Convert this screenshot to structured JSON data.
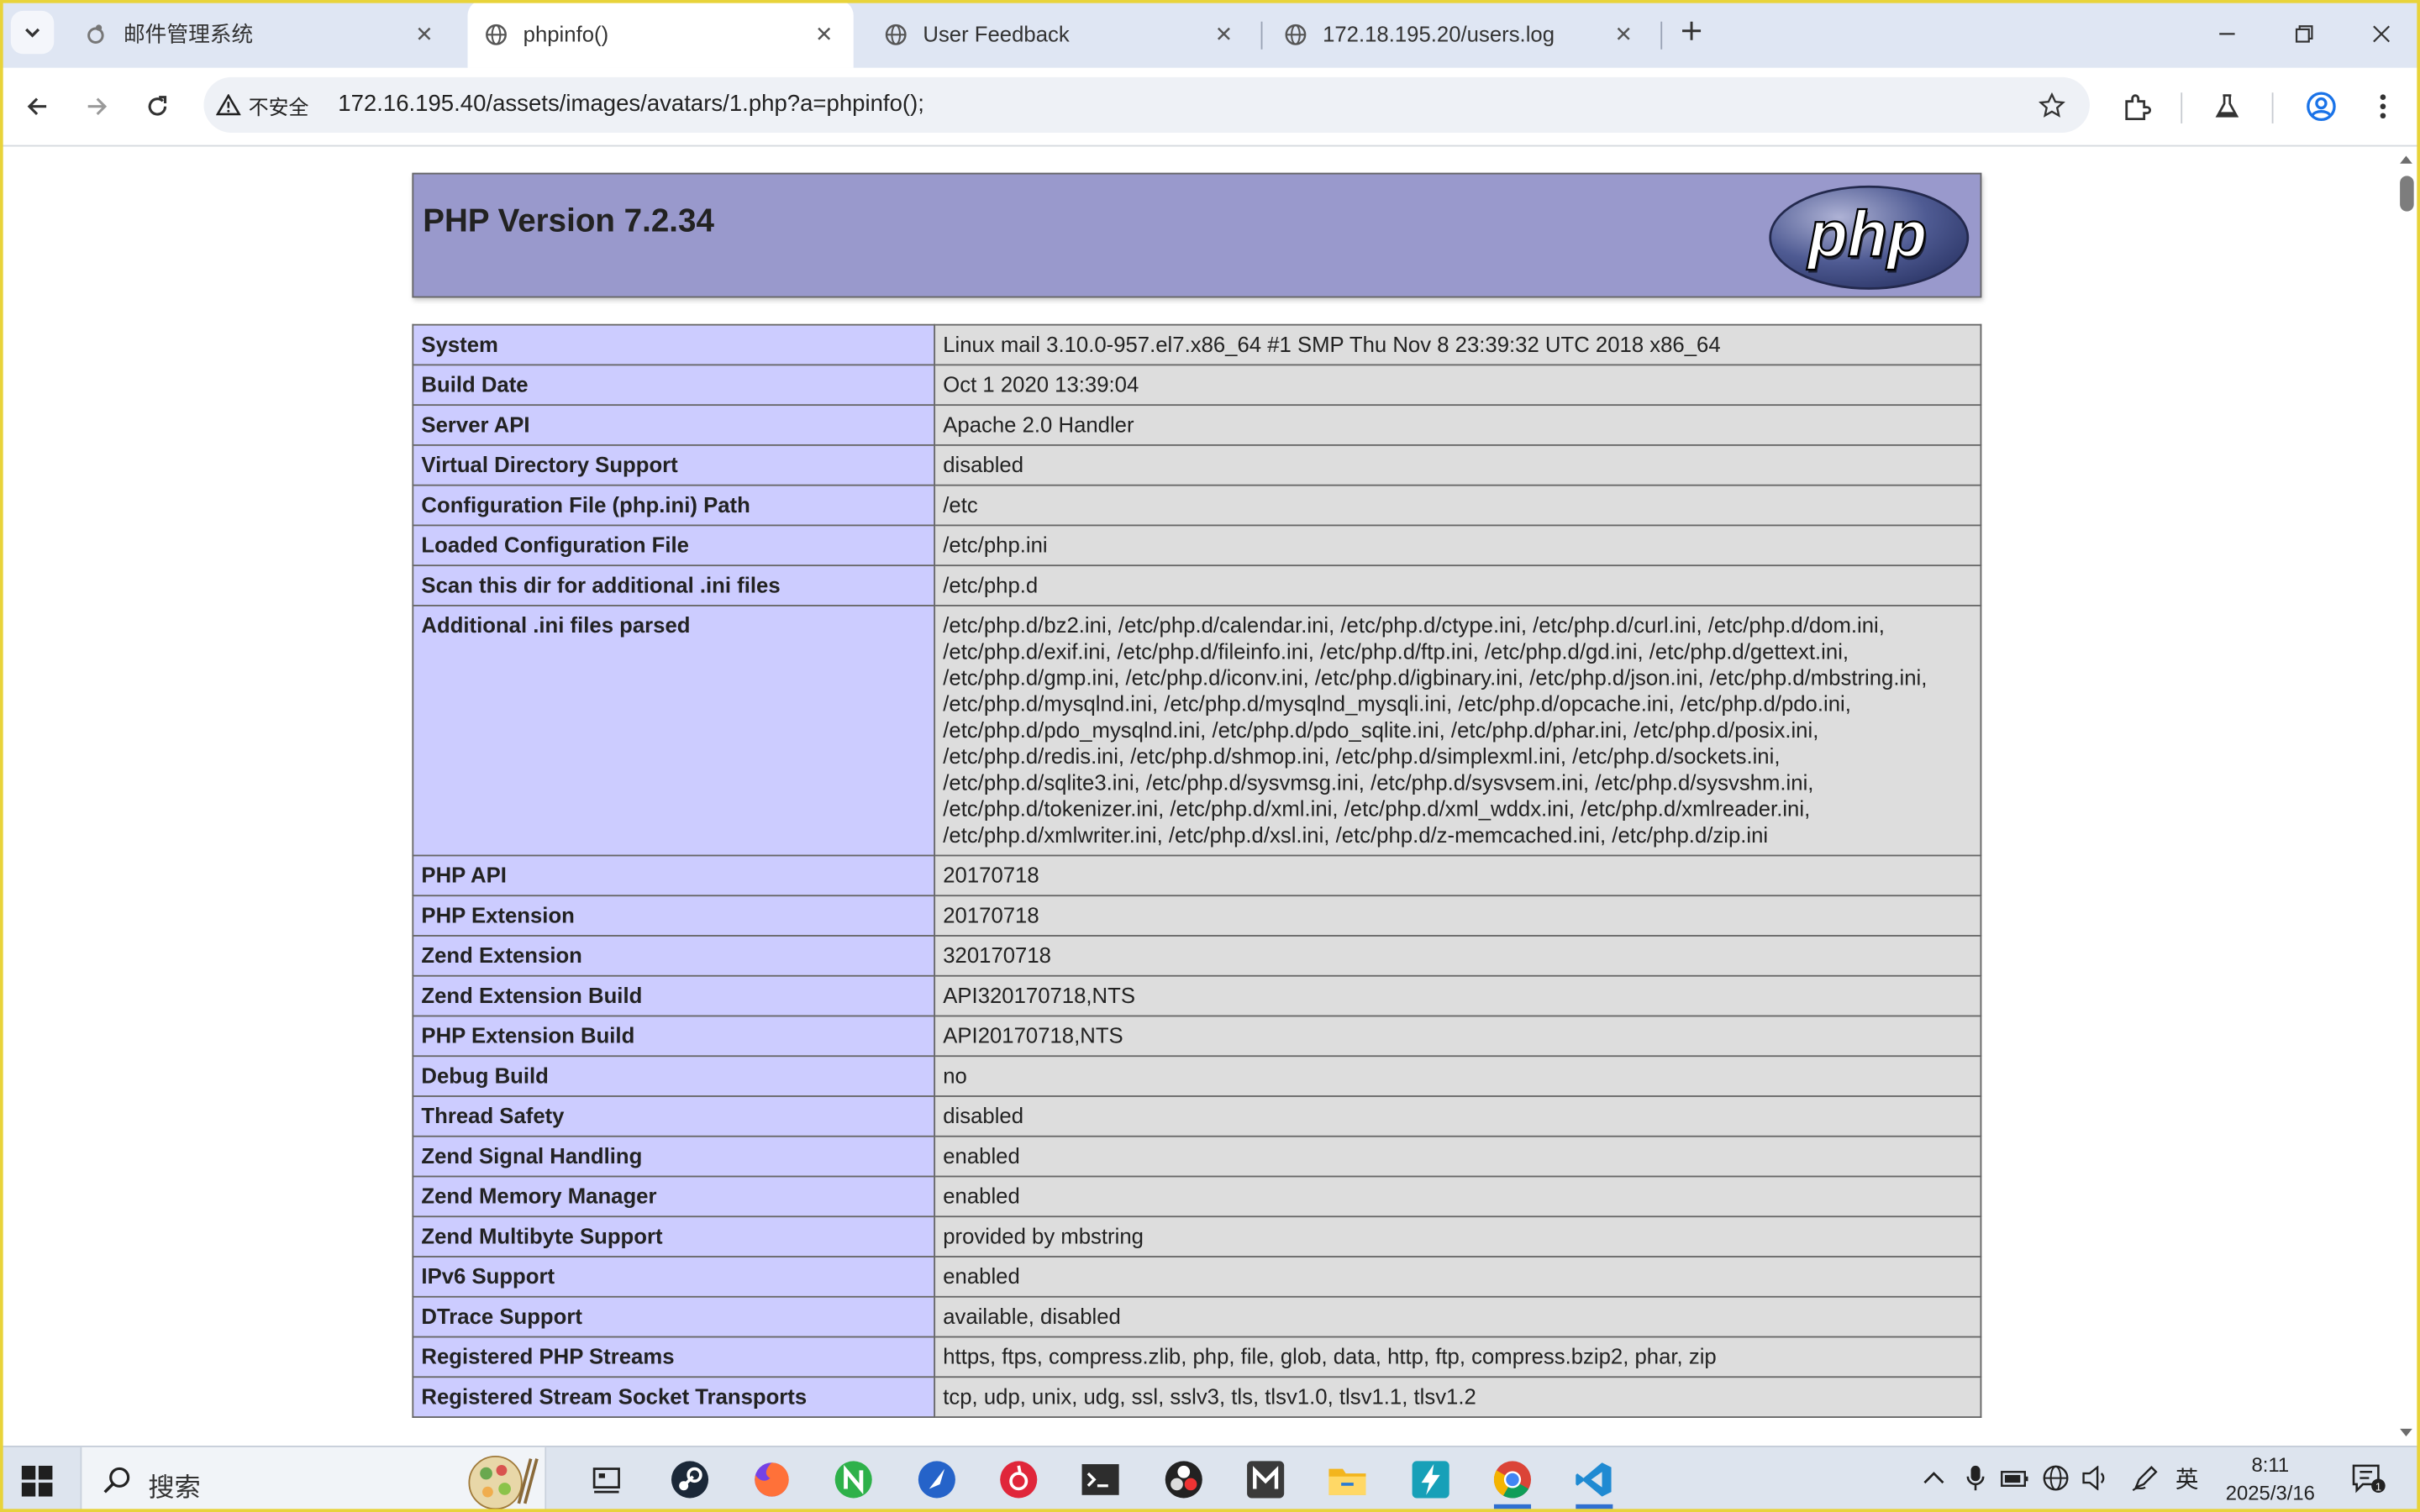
{
  "browser": {
    "tabs": [
      {
        "title": "邮件管理系统",
        "icon": "mail-app-icon",
        "active": false
      },
      {
        "title": "phpinfo()",
        "icon": "globe-icon",
        "active": true
      },
      {
        "title": "User Feedback",
        "icon": "globe-icon",
        "active": false
      },
      {
        "title": "172.18.195.20/users.log",
        "icon": "globe-icon",
        "active": false
      }
    ],
    "security_label": "不安全",
    "url": "172.16.195.40/assets/images/avatars/1.php?a=phpinfo();"
  },
  "page": {
    "header_title": "PHP Version 7.2.34",
    "logo_text": "php",
    "rows": [
      {
        "k": "System",
        "v": "Linux mail 3.10.0-957.el7.x86_64 #1 SMP Thu Nov 8 23:39:32 UTC 2018 x86_64"
      },
      {
        "k": "Build Date",
        "v": "Oct 1 2020 13:39:04"
      },
      {
        "k": "Server API",
        "v": "Apache 2.0 Handler"
      },
      {
        "k": "Virtual Directory Support",
        "v": "disabled"
      },
      {
        "k": "Configuration File (php.ini) Path",
        "v": "/etc"
      },
      {
        "k": "Loaded Configuration File",
        "v": "/etc/php.ini"
      },
      {
        "k": "Scan this dir for additional .ini files",
        "v": "/etc/php.d"
      },
      {
        "k": "Additional .ini files parsed",
        "v": "/etc/php.d/bz2.ini, /etc/php.d/calendar.ini, /etc/php.d/ctype.ini, /etc/php.d/curl.ini, /etc/php.d/dom.ini, /etc/php.d/exif.ini, /etc/php.d/fileinfo.ini, /etc/php.d/ftp.ini, /etc/php.d/gd.ini, /etc/php.d/gettext.ini, /etc/php.d/gmp.ini, /etc/php.d/iconv.ini, /etc/php.d/igbinary.ini, /etc/php.d/json.ini, /etc/php.d/mbstring.ini, /etc/php.d/mysqlnd.ini, /etc/php.d/mysqlnd_mysqli.ini, /etc/php.d/opcache.ini, /etc/php.d/pdo.ini, /etc/php.d/pdo_mysqlnd.ini, /etc/php.d/pdo_sqlite.ini, /etc/php.d/phar.ini, /etc/php.d/posix.ini, /etc/php.d/redis.ini, /etc/php.d/shmop.ini, /etc/php.d/simplexml.ini, /etc/php.d/sockets.ini, /etc/php.d/sqlite3.ini, /etc/php.d/sysvmsg.ini, /etc/php.d/sysvsem.ini, /etc/php.d/sysvshm.ini, /etc/php.d/tokenizer.ini, /etc/php.d/xml.ini, /etc/php.d/xml_wddx.ini, /etc/php.d/xmlreader.ini, /etc/php.d/xmlwriter.ini, /etc/php.d/xsl.ini, /etc/php.d/z-memcached.ini, /etc/php.d/zip.ini"
      },
      {
        "k": "PHP API",
        "v": "20170718"
      },
      {
        "k": "PHP Extension",
        "v": "20170718"
      },
      {
        "k": "Zend Extension",
        "v": "320170718"
      },
      {
        "k": "Zend Extension Build",
        "v": "API320170718,NTS"
      },
      {
        "k": "PHP Extension Build",
        "v": "API20170718,NTS"
      },
      {
        "k": "Debug Build",
        "v": "no"
      },
      {
        "k": "Thread Safety",
        "v": "disabled"
      },
      {
        "k": "Zend Signal Handling",
        "v": "enabled"
      },
      {
        "k": "Zend Memory Manager",
        "v": "enabled"
      },
      {
        "k": "Zend Multibyte Support",
        "v": "provided by mbstring"
      },
      {
        "k": "IPv6 Support",
        "v": "enabled"
      },
      {
        "k": "DTrace Support",
        "v": "available, disabled"
      },
      {
        "k": "Registered PHP Streams",
        "v": "https, ftps, compress.zlib, php, file, glob, data, http, ftp, compress.bzip2, phar, zip"
      },
      {
        "k": "Registered Stream Socket Transports",
        "v": "tcp, udp, unix, udg, ssl, sslv3, tls, tlsv1.0, tlsv1.1, tlsv1.2"
      }
    ]
  },
  "taskbar": {
    "search_label": "搜索",
    "apps": [
      {
        "name": "food-wallpaper-icon",
        "color": "#c8a35a"
      },
      {
        "name": "task-view-icon",
        "color": "#2b2b2b"
      },
      {
        "name": "steam-icon",
        "color": "#1b2838"
      },
      {
        "name": "firefox-icon",
        "color": "#e66000"
      },
      {
        "name": "n-app-icon",
        "color": "#2eb14a"
      },
      {
        "name": "feather-app-icon",
        "color": "#2563c9"
      },
      {
        "name": "netease-music-icon",
        "color": "#e0263a"
      },
      {
        "name": "terminal-icon",
        "color": "#2d2d2d"
      },
      {
        "name": "obs-icon",
        "color": "#222222"
      },
      {
        "name": "m-app-icon",
        "color": "#3a3a3a"
      },
      {
        "name": "file-explorer-icon",
        "color": "#f3b51d"
      },
      {
        "name": "bolt-app-icon",
        "color": "#17a0b8"
      },
      {
        "name": "chrome-icon",
        "color": "#4285f4"
      },
      {
        "name": "vscode-icon",
        "color": "#1f8ad2"
      }
    ],
    "ime_label": "英",
    "time": "8:11",
    "date": "2025/3/16"
  }
}
